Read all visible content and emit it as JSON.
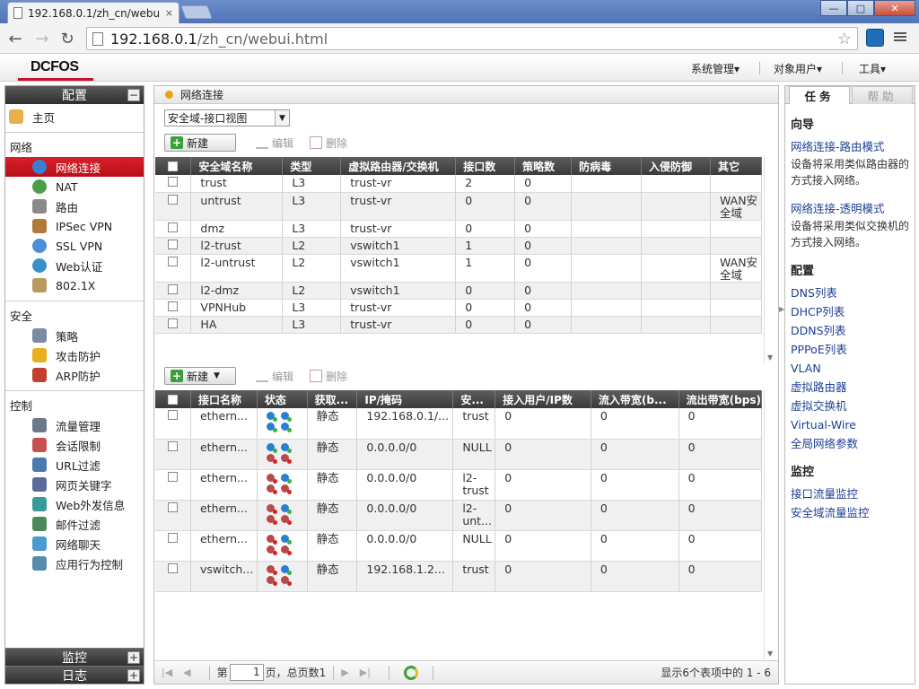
{
  "browser": {
    "tab_title": "192.168.0.1/zh_cn/webu",
    "tab_close": "×",
    "url_host": "192.168.0.1",
    "url_path": "/zh_cn/webui.html",
    "win_min": "—",
    "win_max": "□",
    "win_close": "✕"
  },
  "app": {
    "logo": "DCFOS",
    "menu": [
      "系统管理▾",
      "对象用户▾",
      "工具▾"
    ]
  },
  "left": {
    "config_header": "配置",
    "collapse_sym": "−",
    "expand_sym": "+",
    "home": "主页",
    "groups": [
      {
        "name": "网络",
        "items": [
          "网络连接",
          "NAT",
          "路由",
          "IPSec VPN",
          "SSL VPN",
          "Web认证",
          "802.1X"
        ]
      },
      {
        "name": "安全",
        "items": [
          "策略",
          "攻击防护",
          "ARP防护"
        ]
      },
      {
        "name": "控制",
        "items": [
          "流量管理",
          "会话限制",
          "URL过滤",
          "网页关键字",
          "Web外发信息",
          "邮件过滤",
          "网络聊天",
          "应用行为控制"
        ]
      }
    ],
    "monitor_header": "监控",
    "log_header": "日志"
  },
  "center": {
    "breadcrumb": "网络连接",
    "view_select": "安全域-接口视图",
    "toolbar": {
      "new": "新建",
      "edit": "编辑",
      "delete": "删除"
    },
    "zones": {
      "headers": [
        "安全域名称",
        "类型",
        "虚拟路由器/交换机",
        "接口数",
        "策略数",
        "防病毒",
        "入侵防御",
        "其它"
      ],
      "rows": [
        [
          "trust",
          "L3",
          "trust-vr",
          "2",
          "0",
          "",
          "",
          ""
        ],
        [
          "untrust",
          "L3",
          "trust-vr",
          "0",
          "0",
          "",
          "",
          "WAN安全域"
        ],
        [
          "dmz",
          "L3",
          "trust-vr",
          "0",
          "0",
          "",
          "",
          ""
        ],
        [
          "l2-trust",
          "L2",
          "vswitch1",
          "1",
          "0",
          "",
          "",
          ""
        ],
        [
          "l2-untrust",
          "L2",
          "vswitch1",
          "1",
          "0",
          "",
          "",
          "WAN安全域"
        ],
        [
          "l2-dmz",
          "L2",
          "vswitch1",
          "0",
          "0",
          "",
          "",
          ""
        ],
        [
          "VPNHub",
          "L3",
          "trust-vr",
          "0",
          "0",
          "",
          "",
          ""
        ],
        [
          "HA",
          "L3",
          "trust-vr",
          "0",
          "0",
          "",
          "",
          ""
        ]
      ]
    },
    "interfaces": {
      "headers": [
        "接口名称",
        "状态",
        "获取...",
        "IP/掩码",
        "安...",
        "接入用户/IP数",
        "流入带宽(b...",
        "流出带宽(bps)"
      ],
      "rows": [
        {
          "name": "ethern...",
          "status": [
            "up-ok",
            "up-ok",
            "up-ok",
            "up-ok"
          ],
          "mode": "静态",
          "ip": "192.168.0.1/...",
          "zone": "trust",
          "users": "0",
          "in": "0",
          "out": "0"
        },
        {
          "name": "ethern...",
          "status": [
            "up-ok",
            "up-ok",
            "down-bad",
            "down-bad"
          ],
          "mode": "静态",
          "ip": "0.0.0.0/0",
          "zone": "NULL",
          "users": "0",
          "in": "0",
          "out": "0"
        },
        {
          "name": "ethern...",
          "status": [
            "down-bad",
            "up-ok",
            "down-bad",
            "down-bad"
          ],
          "mode": "静态",
          "ip": "0.0.0.0/0",
          "zone": "l2-trust",
          "users": "0",
          "in": "0",
          "out": "0"
        },
        {
          "name": "ethern...",
          "status": [
            "down-bad",
            "up-ok",
            "down-bad",
            "down-bad"
          ],
          "mode": "静态",
          "ip": "0.0.0.0/0",
          "zone": "l2-unt...",
          "users": "0",
          "in": "0",
          "out": "0"
        },
        {
          "name": "ethern...",
          "status": [
            "down-bad",
            "up-ok",
            "down-bad",
            "down-bad"
          ],
          "mode": "静态",
          "ip": "0.0.0.0/0",
          "zone": "NULL",
          "users": "0",
          "in": "0",
          "out": "0"
        },
        {
          "name": "vswitch...",
          "status": [
            "down-bad",
            "up-ok",
            "down-bad",
            "down-bad"
          ],
          "mode": "静态",
          "ip": "192.168.1.2...",
          "zone": "trust",
          "users": "0",
          "in": "0",
          "out": "0"
        }
      ]
    },
    "pager": {
      "first": "|◀",
      "prev": "◀",
      "page_prefix": "第",
      "page_value": "1",
      "page_suffix": "页，总页数1",
      "next": "▶",
      "last": "▶|",
      "summary": "显示6个表项中的 1 - 6"
    }
  },
  "right": {
    "tab_task": "任务",
    "tab_help": "帮助",
    "guide_head": "向导",
    "guide": [
      {
        "link": "网络连接-路由模式",
        "desc": "设备将采用类似路由器的方式接入网络。"
      },
      {
        "link": "网络连接-透明模式",
        "desc": "设备将采用类似交换机的方式接入网络。"
      }
    ],
    "config_head": "配置",
    "config_links": [
      "DNS列表",
      "DHCP列表",
      "DDNS列表",
      "PPPoE列表",
      "VLAN",
      "虚拟路由器",
      "虚拟交换机",
      "Virtual-Wire",
      "全局网络参数"
    ],
    "monitor_head": "监控",
    "monitor_links": [
      "接口流量监控",
      "安全域流量监控"
    ]
  },
  "colors": {
    "accent_red": "#c8102e",
    "link_blue": "#1c3f94",
    "header_dark": "#3a3a3a"
  }
}
